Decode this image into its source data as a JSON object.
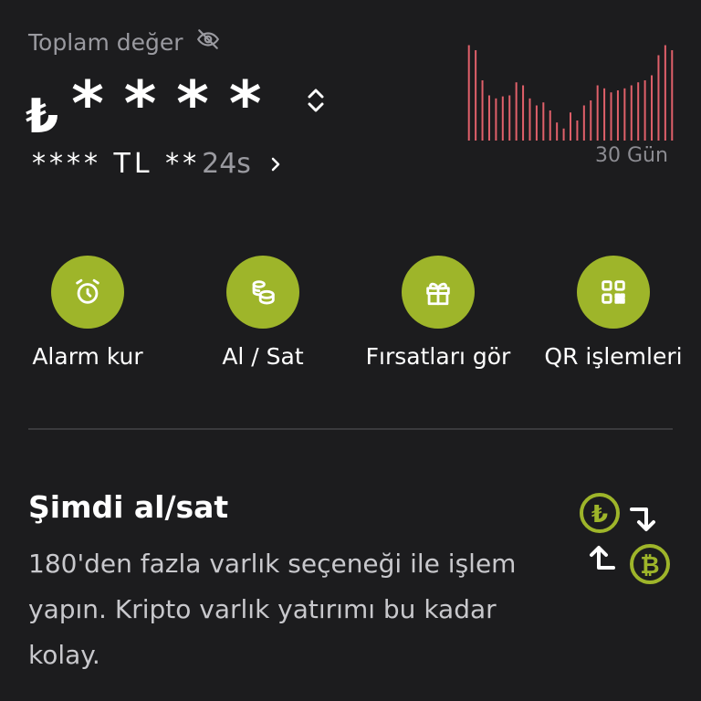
{
  "portfolio": {
    "total_label": "Toplam değer",
    "currency_symbol": "₺",
    "masked_value": "****",
    "sub_masked": "**** TL **",
    "period": "24s",
    "chart_range_label": "30 Gün"
  },
  "actions": [
    {
      "label": "Alarm kur",
      "icon": "alarm-clock-icon"
    },
    {
      "label": "Al / Sat",
      "icon": "coins-icon"
    },
    {
      "label": "Fırsatları gör",
      "icon": "gift-icon"
    },
    {
      "label": "QR işlemleri",
      "icon": "qr-code-icon"
    }
  ],
  "promo": {
    "title": "Şimdi al/sat",
    "body": "180'den fazla varlık seçeneği ile işlem yapın. Kripto varlık yatırımı bu kadar kolay."
  },
  "colors": {
    "background": "#1c1c1e",
    "accent": "#9eb52a",
    "chart_line": "#e0606a",
    "muted_text": "#9a9aa0"
  },
  "chart_data": {
    "type": "bar",
    "values": [
      95,
      90,
      60,
      45,
      42,
      44,
      45,
      58,
      55,
      42,
      35,
      38,
      30,
      18,
      12,
      28,
      20,
      35,
      40,
      55,
      52,
      48,
      50,
      52,
      55,
      58,
      60,
      65,
      85,
      95,
      90
    ],
    "ylim": [
      0,
      100
    ]
  }
}
